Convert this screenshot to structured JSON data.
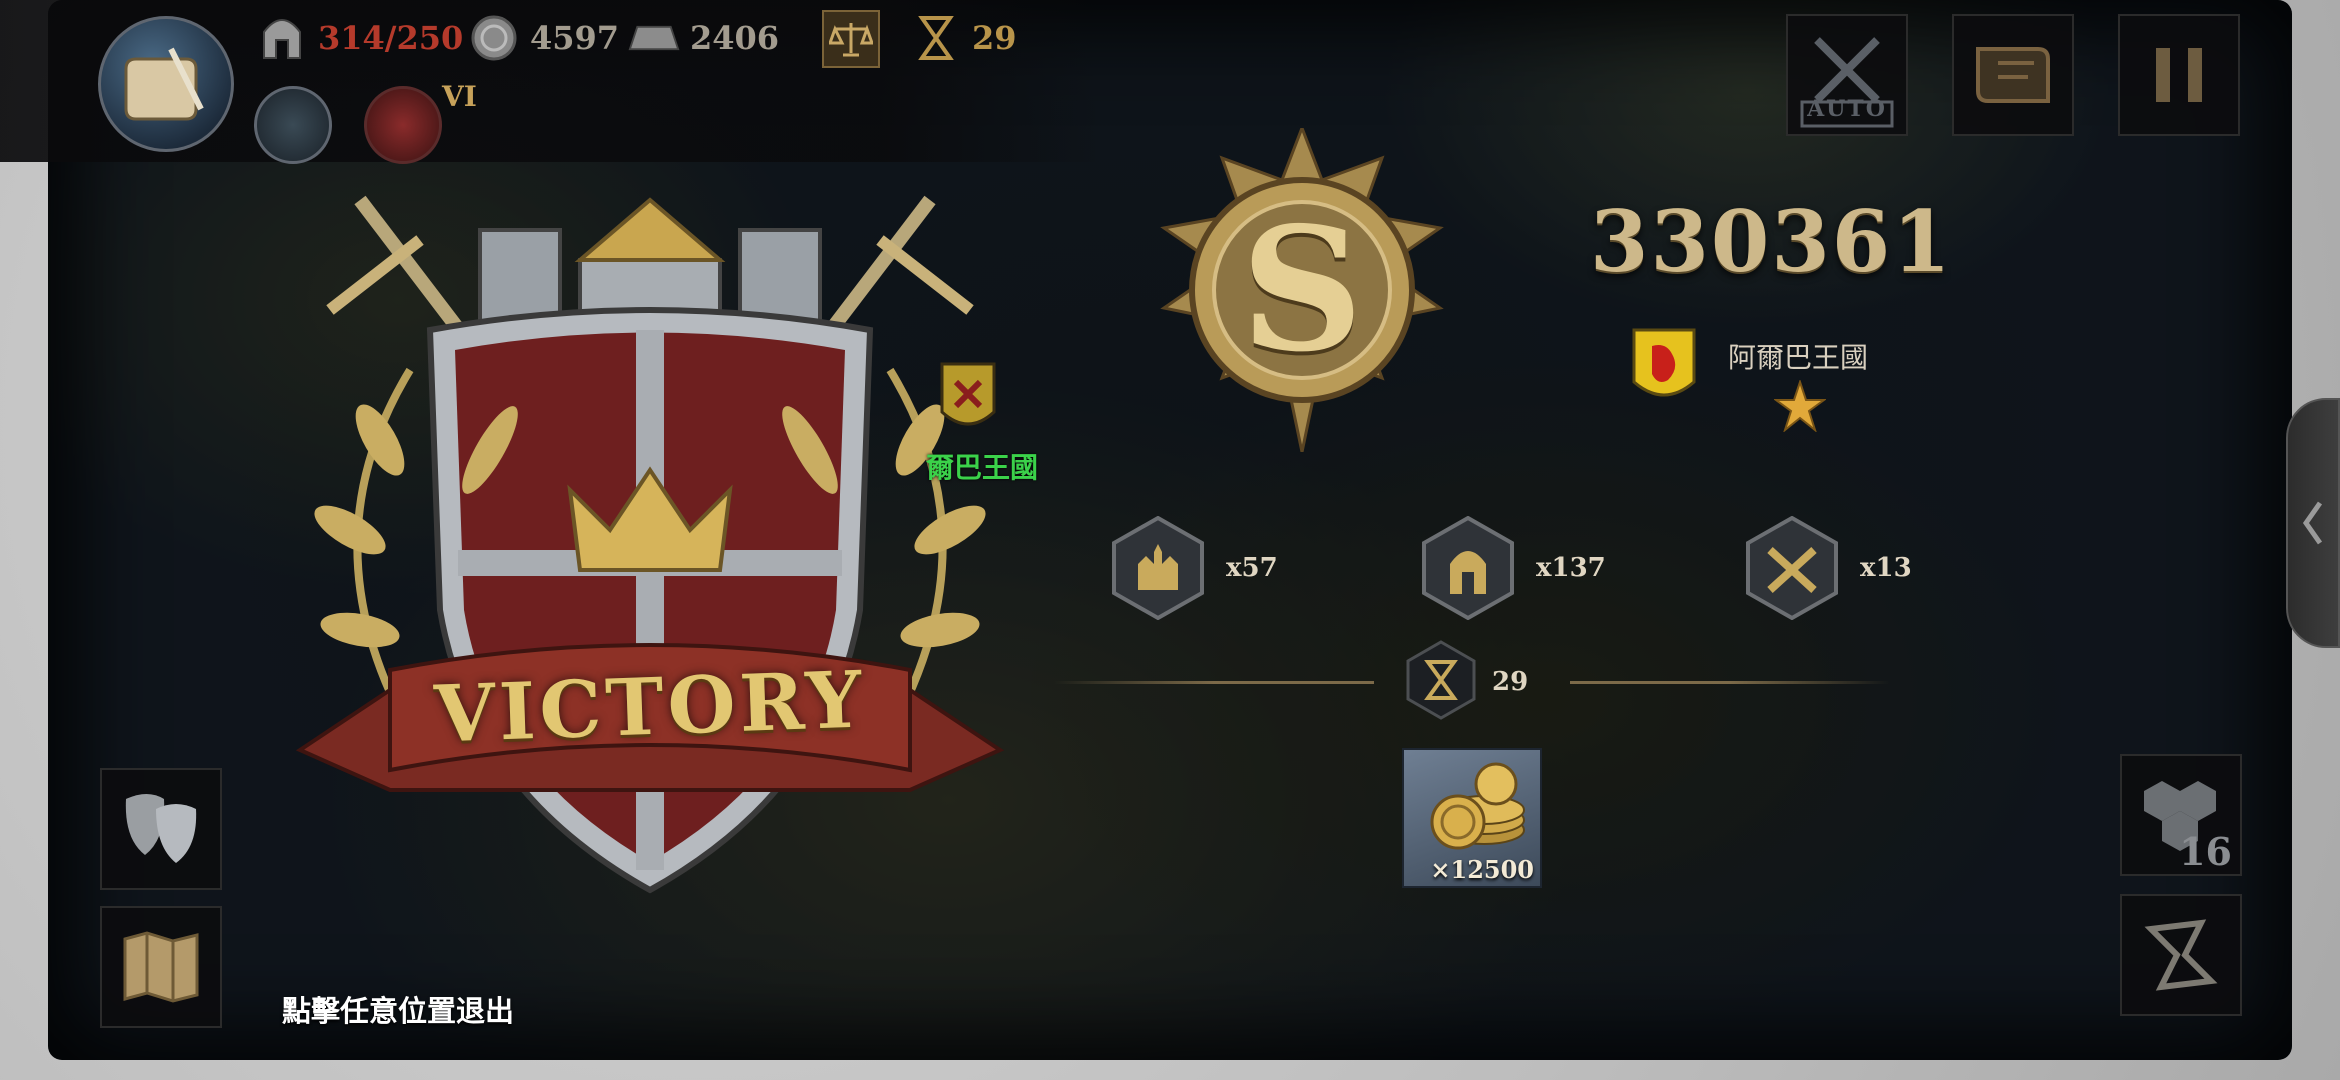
{
  "resources": {
    "troops": "314/250",
    "silver": "4597",
    "iron": "2406",
    "turns": "29",
    "level": "VI"
  },
  "colors": {
    "troops_over_limit": "#b53a2b",
    "gold_accent": "#cdb88a",
    "green_label": "#3bd24a"
  },
  "top_buttons": {
    "auto_label": "AUTO"
  },
  "map": {
    "territory_label": "爾巴王國"
  },
  "result": {
    "title": "VICTORY",
    "rank": "S",
    "score": "330361",
    "kingdom": "阿爾巴王國",
    "stars": 1,
    "stats": [
      {
        "icon": "castle-icon",
        "value": "x57"
      },
      {
        "icon": "helmet-icon",
        "value": "x137"
      },
      {
        "icon": "crossed-swords-icon",
        "value": "x13"
      }
    ],
    "turns_used": "29",
    "reward_qty": "×12500"
  },
  "exit_hint": "點擊任意位置退出",
  "hex_count": "16"
}
